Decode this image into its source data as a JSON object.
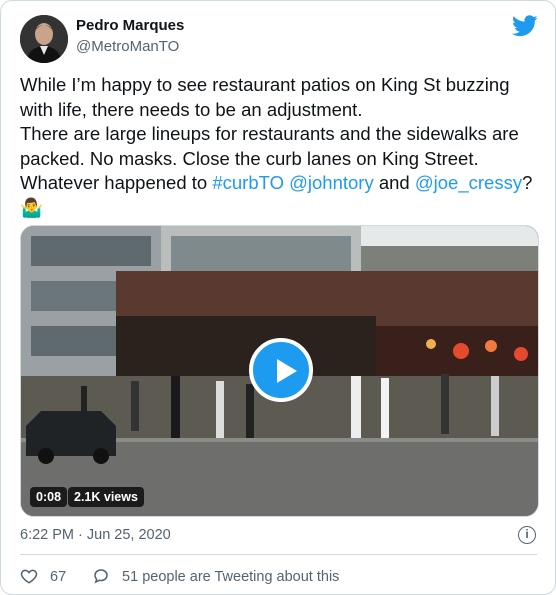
{
  "author": {
    "name": "Pedro Marques",
    "handle": "@MetroManTO"
  },
  "tweet": {
    "line1": "While I’m happy to see restaurant patios on King St buzzing with life, there needs to be an adjustment.",
    "line2": "There are large lineups for restaurants and the sidewalks are packed. No masks. Close the curb lanes on King Street.",
    "line3_prefix": "Whatever happened to ",
    "hashtag": "#curbTO",
    "mention1": "@johntory",
    "connector": " and ",
    "mention2": "@joe_cressy",
    "suffix": "?",
    "emoji": "🤷‍♂️"
  },
  "video": {
    "duration": "0:08",
    "views": "2.1K views"
  },
  "timestamp": "6:22 PM · Jun 25, 2020",
  "engagement": {
    "likes": "67",
    "conversation": "51 people are Tweeting about this"
  },
  "colors": {
    "accent": "#1d9bf0",
    "secondary_text": "#536471",
    "border": "#cfd9de"
  },
  "icons": [
    "twitter-bird-icon",
    "play-icon",
    "info-icon",
    "heart-icon",
    "comment-icon"
  ]
}
